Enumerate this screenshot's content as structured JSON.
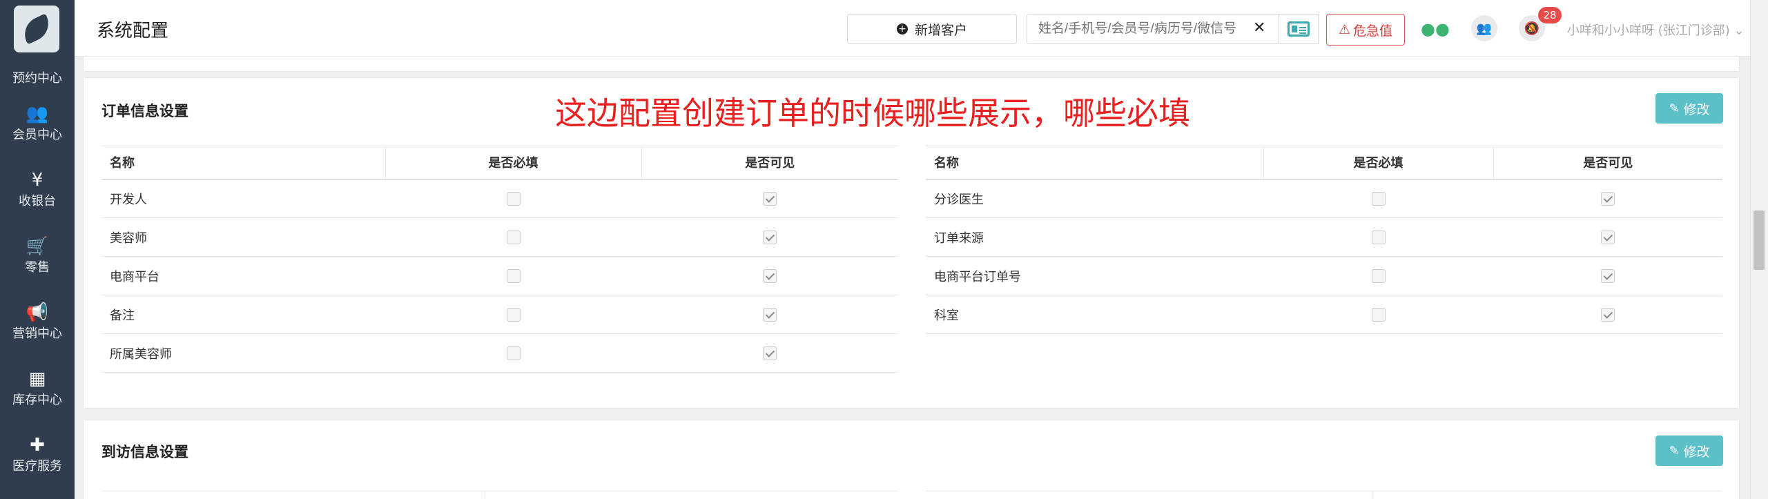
{
  "sidebar": {
    "partial_label": "预约中心",
    "items": [
      {
        "icon": "users-icon",
        "glyph": "👥",
        "label": "会员中心"
      },
      {
        "icon": "yen-icon",
        "glyph": "¥",
        "label": "收银台"
      },
      {
        "icon": "cart-icon",
        "glyph": "🛒",
        "label": "零售"
      },
      {
        "icon": "megaphone-icon",
        "glyph": "📢",
        "label": "营销中心"
      },
      {
        "icon": "grid-icon",
        "glyph": "▦",
        "label": "库存中心"
      },
      {
        "icon": "medkit-icon",
        "glyph": "✚",
        "label": "医疗服务"
      }
    ]
  },
  "header": {
    "title": "系统配置",
    "add_customer": "新增客户",
    "search_placeholder": "姓名/手机号/会员号/病历号/微信号",
    "critical_value": "危急值",
    "critical_glyph": "⚠",
    "badge_count": "28",
    "user": "小咩和小小咩呀 (张江门诊部)"
  },
  "annotation": "这边配置创建订单的时候哪些展示，哪些必填",
  "order_settings": {
    "title": "订单信息设置",
    "edit_label": "修改",
    "left_table": {
      "headers": [
        "名称",
        "是否必填",
        "是否可见"
      ],
      "rows": [
        {
          "name": "开发人",
          "required": false,
          "visible": true
        },
        {
          "name": "美容师",
          "required": false,
          "visible": true
        },
        {
          "name": "电商平台",
          "required": false,
          "visible": true
        },
        {
          "name": "备注",
          "required": false,
          "visible": true
        },
        {
          "name": "所属美容师",
          "required": false,
          "visible": true
        }
      ]
    },
    "right_table": {
      "headers": [
        "名称",
        "是否必填",
        "是否可见"
      ],
      "rows": [
        {
          "name": "分诊医生",
          "required": false,
          "visible": true
        },
        {
          "name": "订单来源",
          "required": false,
          "visible": true
        },
        {
          "name": "电商平台订单号",
          "required": false,
          "visible": true
        },
        {
          "name": "科室",
          "required": false,
          "visible": true
        }
      ]
    }
  },
  "visit_settings": {
    "title": "到访信息设置",
    "edit_label": "修改"
  },
  "colors": {
    "sidebar_bg": "#2f3d4e",
    "accent": "#5bc0c7",
    "danger": "#d63b3b",
    "annotation": "#ea1f1f"
  }
}
